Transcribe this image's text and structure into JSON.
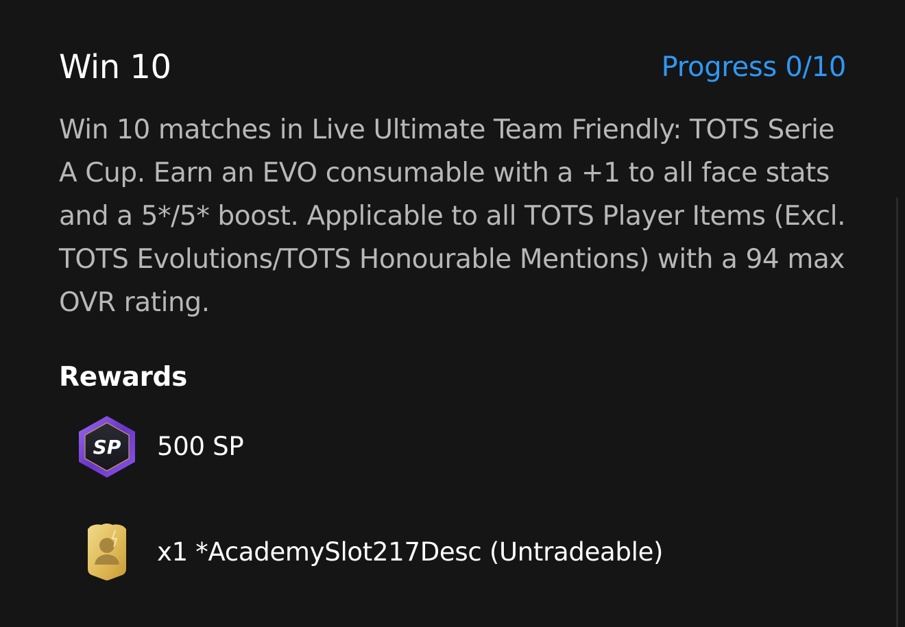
{
  "objective": {
    "title": "Win 10",
    "progress_text": "Progress 0/10",
    "progress": {
      "current": 0,
      "total": 10
    },
    "description": "Win 10 matches in Live Ultimate Team Friendly: TOTS Serie A Cup. Earn an EVO consumable with a +1 to all face stats and a 5*/5* boost. Applicable to all TOTS Player Items (Excl. TOTS Evolutions/TOTS Honourable Mentions) with a 94 max OVR rating.",
    "rewards_heading": "Rewards",
    "rewards": [
      {
        "icon": "sp-hexagon-icon",
        "badge_text": "SP",
        "label": "500 SP"
      },
      {
        "icon": "player-item-card-icon",
        "label": "x1 *AcademySlot217Desc (Untradeable)"
      }
    ]
  },
  "colors": {
    "background": "#151515",
    "title": "#ffffff",
    "progress": "#2f98f5",
    "description": "#b8b8b8",
    "sp_badge_purple": "#7b45d6",
    "card_gold": "#e3bf5d"
  }
}
